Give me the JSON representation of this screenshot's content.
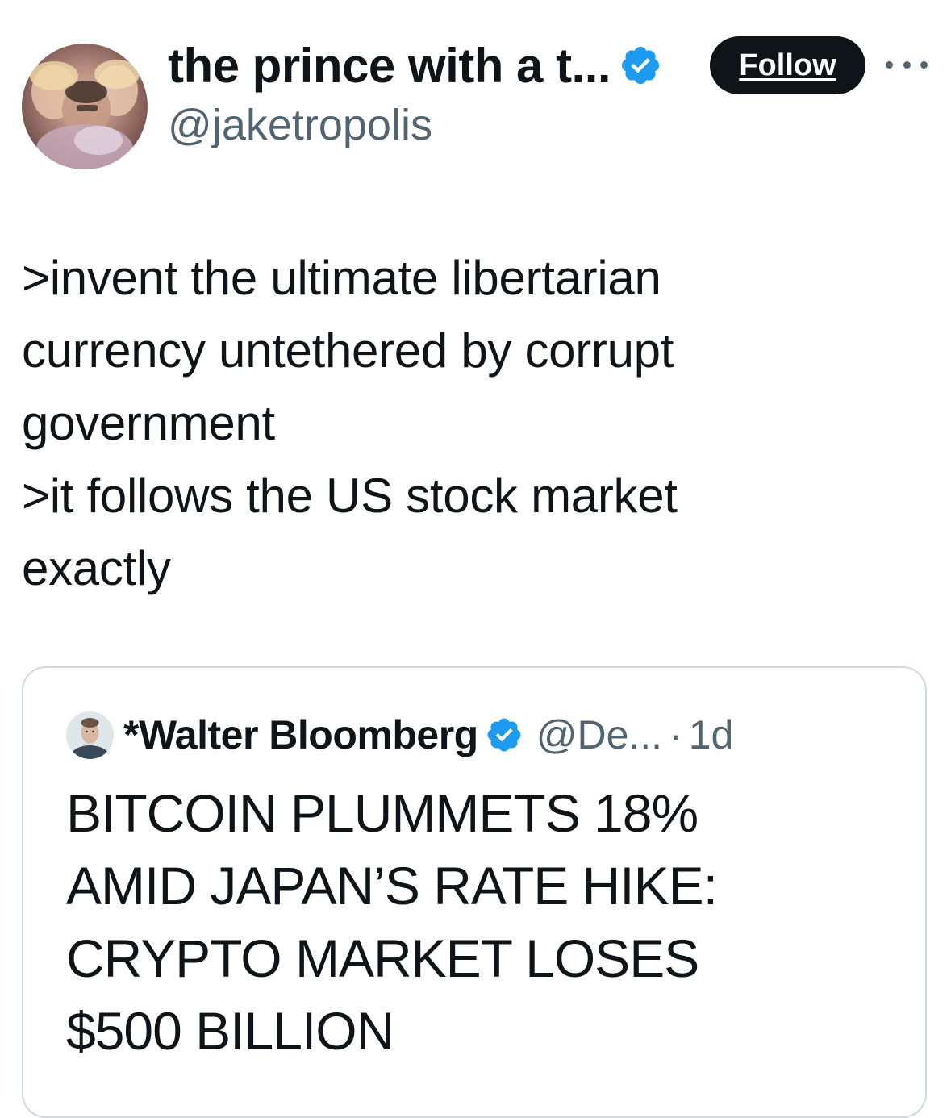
{
  "tweet": {
    "author": {
      "display_name": "the prince with a t...",
      "handle": "@jaketropolis",
      "verified": true,
      "verified_color": "#1d9bf0"
    },
    "follow_label": "Follow",
    "more_icon": "more-horizontal-icon",
    "text_lines": [
      ">invent the ultimate libertarian",
      "currency untethered by corrupt",
      "government",
      ">it follows the US stock market",
      "exactly"
    ]
  },
  "quoted_tweet": {
    "author": {
      "display_name": "*Walter Bloomberg",
      "handle": "@De...",
      "verified": true
    },
    "separator": "·",
    "timestamp": "1d",
    "text_lines": [
      "BITCOIN PLUMMETS 18%",
      "AMID JAPAN’S RATE HIKE:",
      "CRYPTO MARKET LOSES",
      "$500 BILLION"
    ]
  },
  "colors": {
    "text_primary": "#0f1419",
    "text_secondary": "#536471",
    "border": "#cfd9de",
    "button_bg": "#0f1419"
  }
}
